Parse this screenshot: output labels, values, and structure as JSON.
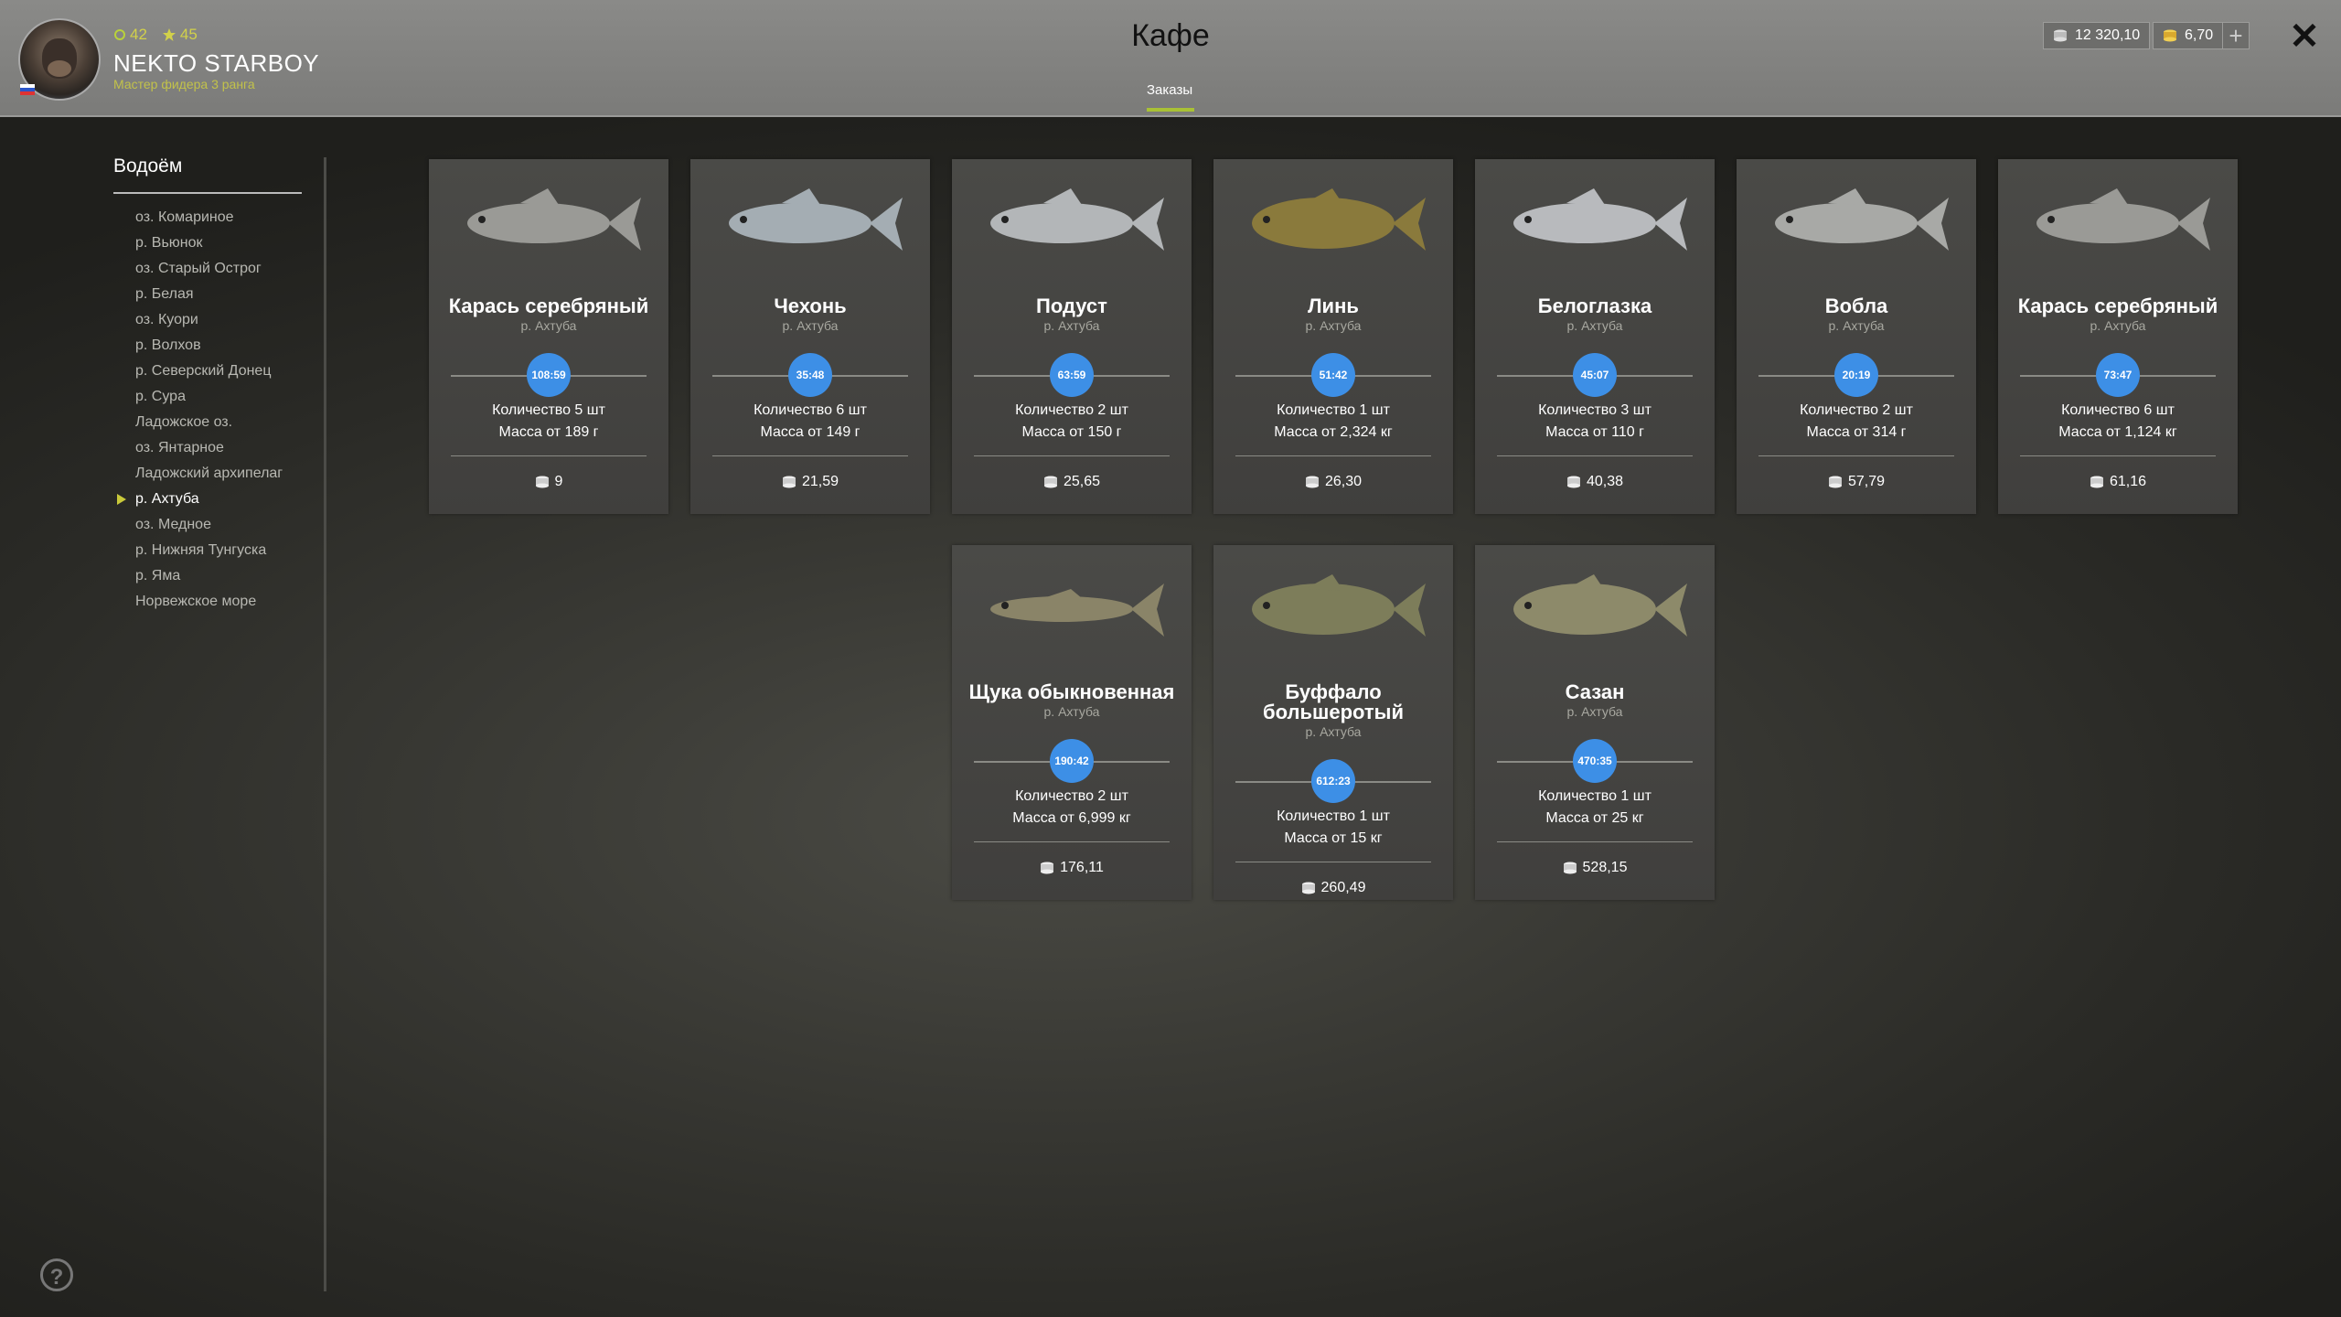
{
  "header": {
    "title": "Кафе",
    "tab_orders": "Заказы",
    "player": {
      "level": "42",
      "rating": "45",
      "name": "NEKTO STARBOY",
      "rank": "Мастер фидера 3 ранга"
    },
    "currency_silver": "12 320,10",
    "currency_gold": "6,70",
    "plus_label": "+",
    "close_label": "✕"
  },
  "sidebar": {
    "title": "Водоём",
    "items": [
      {
        "label": "оз. Комариное"
      },
      {
        "label": "р. Вьюнок"
      },
      {
        "label": "оз. Старый Острог"
      },
      {
        "label": "р. Белая"
      },
      {
        "label": "оз. Куори"
      },
      {
        "label": "р. Волхов"
      },
      {
        "label": "р. Северский Донец"
      },
      {
        "label": "р. Сура"
      },
      {
        "label": "Ладожское оз."
      },
      {
        "label": "оз. Янтарное"
      },
      {
        "label": "Ладожский архипелаг"
      },
      {
        "label": "р. Ахтуба",
        "active": true
      },
      {
        "label": "оз. Медное"
      },
      {
        "label": "р. Нижняя Тунгуска"
      },
      {
        "label": "р. Яма"
      },
      {
        "label": "Норвежское море"
      }
    ]
  },
  "orders": [
    {
      "name": "Карась серебряный",
      "location": "р. Ахтуба",
      "timer": "108:59",
      "quantity": "Количество 5 шт",
      "mass": "Масса от 189 г",
      "price": "9",
      "fish_color": "#9a9a96"
    },
    {
      "name": "Чехонь",
      "location": "р. Ахтуба",
      "timer": "35:48",
      "quantity": "Количество 6 шт",
      "mass": "Масса от 149 г",
      "price": "21,59",
      "fish_color": "#a4adb3"
    },
    {
      "name": "Подуст",
      "location": "р. Ахтуба",
      "timer": "63:59",
      "quantity": "Количество 2 шт",
      "mass": "Масса от 150 г",
      "price": "25,65",
      "fish_color": "#b3b6b8"
    },
    {
      "name": "Линь",
      "location": "р. Ахтуба",
      "timer": "51:42",
      "quantity": "Количество 1 шт",
      "mass": "Масса от 2,324 кг",
      "price": "26,30",
      "fish_color": "#8a7a3c"
    },
    {
      "name": "Белоглазка",
      "location": "р. Ахтуба",
      "timer": "45:07",
      "quantity": "Количество 3 шт",
      "mass": "Масса от 110 г",
      "price": "40,38",
      "fish_color": "#b8babd"
    },
    {
      "name": "Вобла",
      "location": "р. Ахтуба",
      "timer": "20:19",
      "quantity": "Количество 2 шт",
      "mass": "Масса от 314 г",
      "price": "57,79",
      "fish_color": "#a8a9a6"
    },
    {
      "name": "Карась серебряный",
      "location": "р. Ахтуба",
      "timer": "73:47",
      "quantity": "Количество 6 шт",
      "mass": "Масса от 1,124 кг",
      "price": "61,16",
      "fish_color": "#9a9a96"
    },
    {
      "name": "Щука обыкновенная",
      "location": "р. Ахтуба",
      "timer": "190:42",
      "quantity": "Количество 2 шт",
      "mass": "Масса от 6,999 кг",
      "price": "176,11",
      "fish_color": "#8a8468"
    },
    {
      "name": "Буффало большеротый",
      "location": "р. Ахтуба",
      "timer": "612:23",
      "quantity": "Количество 1 шт",
      "mass": "Масса от 15 кг",
      "price": "260,49",
      "fish_color": "#7d7d5a"
    },
    {
      "name": "Сазан",
      "location": "р. Ахтуба",
      "timer": "470:35",
      "quantity": "Количество 1 шт",
      "mass": "Масса от 25 кг",
      "price": "528,15",
      "fish_color": "#8d8a6a"
    }
  ],
  "help_label": "?",
  "colors": {
    "accent": "#a9c135",
    "timer": "#3d8fe6"
  }
}
